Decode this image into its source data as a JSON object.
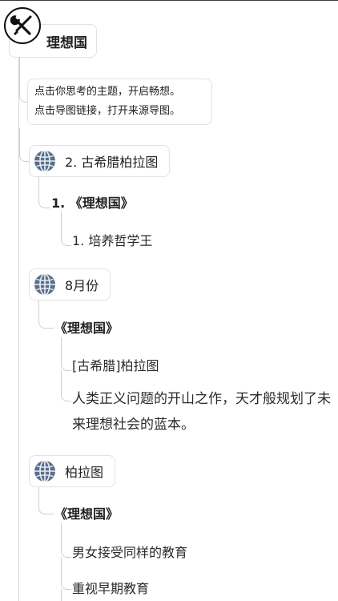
{
  "root": {
    "title": "理想国"
  },
  "note": {
    "line1": "点击你思考的主题，开启畅想。",
    "line2": "点击导图链接，打开来源导图。"
  },
  "sections": [
    {
      "topic": "2. 古希腊柏拉图",
      "child": "1. 《理想国》",
      "items": [
        "1. 培养哲学王"
      ]
    },
    {
      "topic": "8月份",
      "child": "《理想国》",
      "items": [
        "[古希腊]柏拉图",
        "人类正义问题的开山之作，天才般规划了未来理想社会的蓝本。"
      ]
    },
    {
      "topic": "柏拉图",
      "child": "《理想国》",
      "items": [
        "男女接受同样的教育",
        "重视早期教育"
      ]
    }
  ],
  "icons": {
    "tool": "wrench-screwdriver-icon",
    "topic": "globe-icon"
  }
}
